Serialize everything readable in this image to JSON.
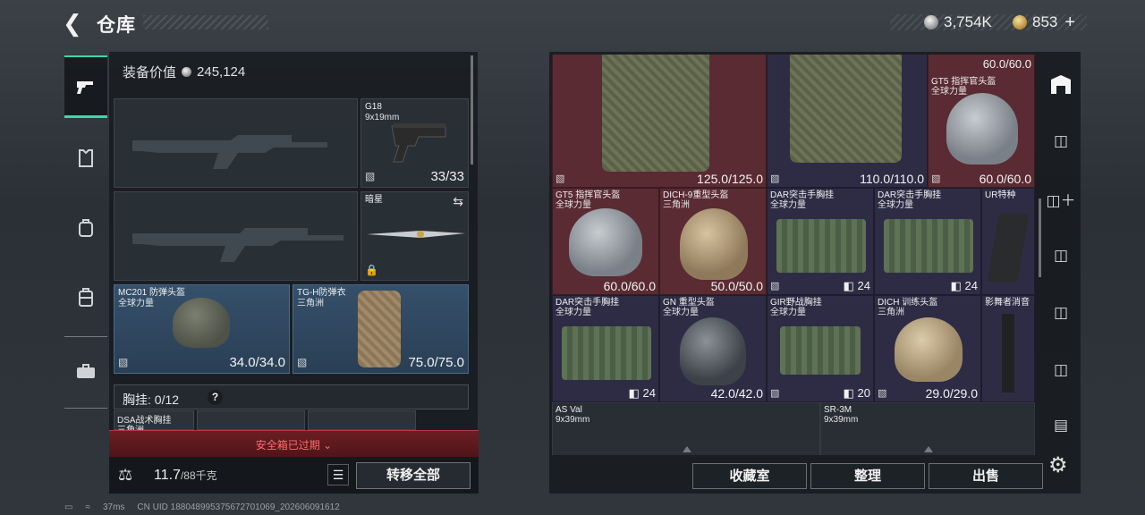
{
  "header": {
    "title": "仓库",
    "back_icon": "back-arrow-icon"
  },
  "currency": {
    "silver": "3,754K",
    "gold": "853",
    "plus": "+"
  },
  "sidenav": [
    "pistol-icon",
    "armor-icon",
    "backpack-icon",
    "container-icon",
    "briefcase-icon"
  ],
  "equipment": {
    "value_label": "装备价值",
    "value": "245,124",
    "pistol": {
      "name": "G18",
      "ammo": "9x19mm",
      "durability": "33/33"
    },
    "melee": {
      "name": "暗星"
    },
    "helmet": {
      "name": "MC201 防弹头盔",
      "origin": "全球力量",
      "durability": "34.0/34.0"
    },
    "armor": {
      "name": "TG-H防弹衣",
      "origin": "三角洲",
      "durability": "75.0/75.0"
    },
    "chest_rig_label": "胸挂:",
    "chest_rig_count": "0/12",
    "help": "?",
    "rig_item_name": "DSA战术胸挂",
    "rig_item_sub": "三角洲"
  },
  "safebox": {
    "expired": "安全箱已过期"
  },
  "bottom": {
    "weight": "11.7",
    "weight_max": "/88千克",
    "transfer_all": "转移全部"
  },
  "grid": {
    "row1": [
      {
        "value": "125.0/125.0"
      },
      {
        "value": "110.0/110.0"
      },
      {
        "value_top": "60.0/60.0",
        "name": "GT5 指挥官头盔",
        "origin": "全球力量",
        "value": "60.0/60.0"
      }
    ],
    "row2": [
      {
        "name": "GT5 指挥官头盔",
        "origin": "全球力量",
        "value": "60.0/60.0"
      },
      {
        "name": "DICH-9重型头盔",
        "origin": "三角洲",
        "value": "50.0/50.0"
      },
      {
        "name": "DAR突击手胸挂",
        "origin": "全球力量",
        "count": "24"
      },
      {
        "name": "DAR突击手胸挂",
        "origin": "全球力量",
        "count": "24"
      },
      {
        "name": "UR特种"
      }
    ],
    "row3": [
      {
        "name": "DAR突击手胸挂",
        "origin": "全球力量",
        "count": "24"
      },
      {
        "name": "GN 重型头盔",
        "origin": "全球力量",
        "value": "42.0/42.0"
      },
      {
        "name": "GIR野战胸挂",
        "origin": "全球力量",
        "count": "20"
      },
      {
        "name": "DICH 训练头盔",
        "origin": "三角洲",
        "value": "29.0/29.0"
      },
      {
        "name": "影舞者消音"
      }
    ],
    "row4": [
      {
        "name": "AS Val",
        "ammo": "9x39mm"
      },
      {
        "name": "SR-3M",
        "ammo": "9x39mm"
      }
    ]
  },
  "actions": {
    "collection": "收藏室",
    "sort": "整理",
    "sell": "出售"
  },
  "status": {
    "ping": "37ms",
    "uid": "CN UID 188048995375672701069_202606091612"
  }
}
